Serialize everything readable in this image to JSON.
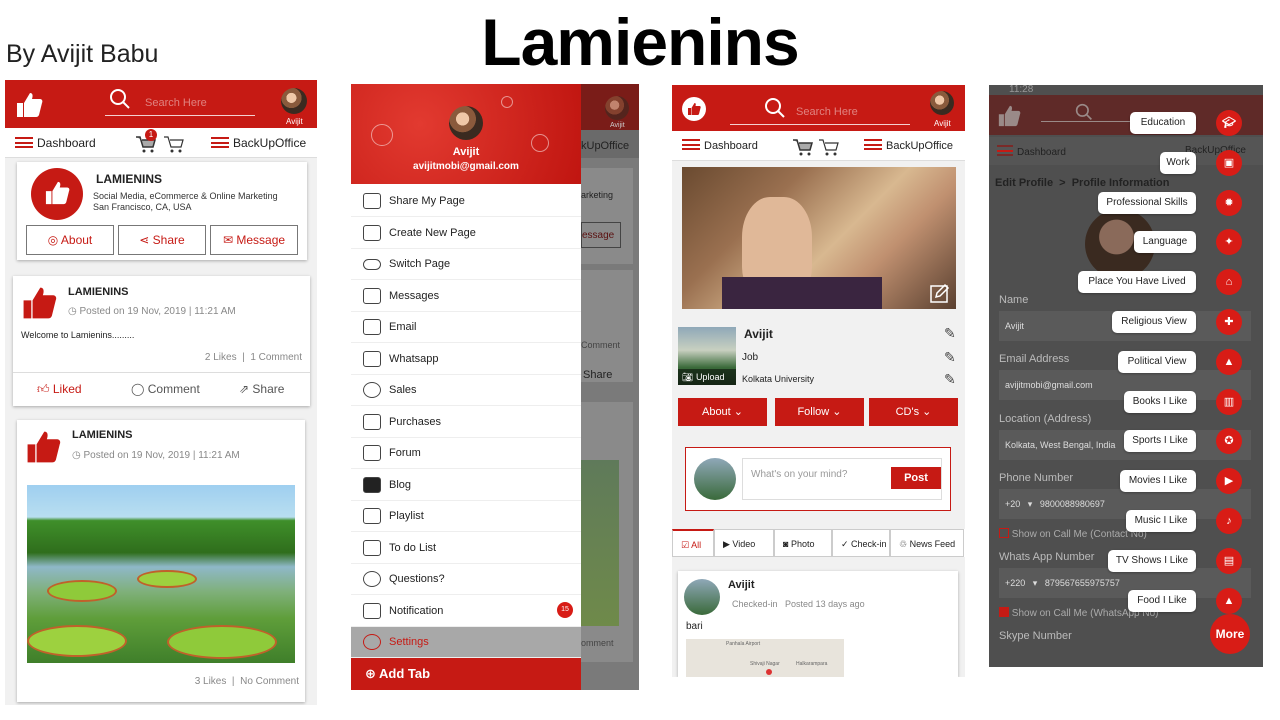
{
  "header": {
    "title": "Lamienins",
    "byline": "By Avijit Babu"
  },
  "colors": {
    "brand": "#c61a14",
    "dark_overlay": "#4a4a4a"
  },
  "icons": [
    "thumbs-up-icon",
    "search-icon",
    "hamburger-icon",
    "cart-icon",
    "user-circle-icon",
    "share-icon",
    "envelope-icon",
    "clock-icon",
    "comment-icon",
    "camera-icon",
    "edit-icon",
    "chevron-down-icon",
    "settings-icon",
    "plus-circle-icon"
  ],
  "screen1": {
    "avatar_name": "Avijit",
    "search_placeholder": "Search Here",
    "nav": {
      "dashboard": "Dashboard",
      "badge": "1",
      "backup": "BackUpOffice"
    },
    "page": {
      "name": "LAMIENINS",
      "desc1": "Social Media, eCommerce & Online Marketing",
      "desc2": "San Francisco, CA, USA",
      "about": "About",
      "share": "Share",
      "message": "Message"
    },
    "post1": {
      "author": "LAMIENINS",
      "posted": "Posted on 19 Nov, 2019 | 11:21 AM",
      "text": "Welcome to Lamienins.........",
      "likes": "2 Likes",
      "comments": "1 Comment",
      "liked": "Liked",
      "comment": "Comment",
      "share": "Share"
    },
    "post2": {
      "author": "LAMIENINS",
      "posted": "Posted on 19 Nov, 2019 | 11:21 AM",
      "likes": "3 Likes",
      "comments": "No Comment"
    }
  },
  "screen2": {
    "name": "Avijit",
    "email": "avijitmobi@gmail.com",
    "bg_texts": {
      "avatar": "Avijit",
      "backup": "kUpOffice",
      "marketing": "arketing",
      "message": "essage",
      "comment": "Comment",
      "share": "Share",
      "comment2": "omment"
    },
    "menu": [
      "Share My Page",
      "Create New Page",
      "Switch Page",
      "Messages",
      "Email",
      "Whatsapp",
      "Sales",
      "Purchases",
      "Forum",
      "Blog",
      "Playlist",
      "To do List",
      "Questions?",
      "Notification",
      "Settings"
    ],
    "notification_count": "15",
    "add_tab": "Add Tab"
  },
  "screen3": {
    "avatar_name": "Avijit",
    "search_placeholder": "Search Here",
    "nav": {
      "dashboard": "Dashboard",
      "backup": "BackUpOffice"
    },
    "profile": {
      "name": "Avijit",
      "job": "Job",
      "edu": "Kolkata University",
      "upload": "Upload"
    },
    "buttons": {
      "about": "About",
      "follow": "Follow",
      "cds": "CD's"
    },
    "composer": {
      "placeholder": "What's on your mind?",
      "post": "Post"
    },
    "tabs": [
      "All",
      "Video",
      "Photo",
      "Check-in",
      "News Feed"
    ],
    "feed": {
      "name": "Avijit",
      "checked": "Checked-in",
      "posted": "Posted 13 days ago",
      "text": "bari",
      "map1": "Panhala Airport",
      "map2": "Shivaji Nagar",
      "map3": "Halkarampara"
    }
  },
  "screen4": {
    "time": "11:28",
    "nav": {
      "dashboard": "Dashboard",
      "backup": "BackUpOffice"
    },
    "crumb": "Edit Profile  >  Profile Information",
    "labels": {
      "name": "Name",
      "email": "Email Address",
      "location": "Location (Address)",
      "phone": "Phone Number",
      "whatsapp": "Whats App Number",
      "skype": "Skype Number"
    },
    "values": {
      "name": "Avijit",
      "email": "avijitmobi@gmail.com",
      "location": "Kolkata, West Bengal, India",
      "phone_code": "+20",
      "phone": "9800088980697",
      "wa_code": "+220",
      "wa": "879567655975757"
    },
    "checks": {
      "phone": "Show on Call Me (Contact No)",
      "wa": "Show on Call Me (WhatsApp No)"
    },
    "menu": [
      "Education",
      "Work",
      "Professional Skills",
      "Language",
      "Place You Have Lived",
      "Religious View",
      "Political View",
      "Books I Like",
      "Sports I Like",
      "Movies I Like",
      "Music I Like",
      "TV Shows I Like",
      "Food I Like"
    ],
    "more": "More"
  }
}
